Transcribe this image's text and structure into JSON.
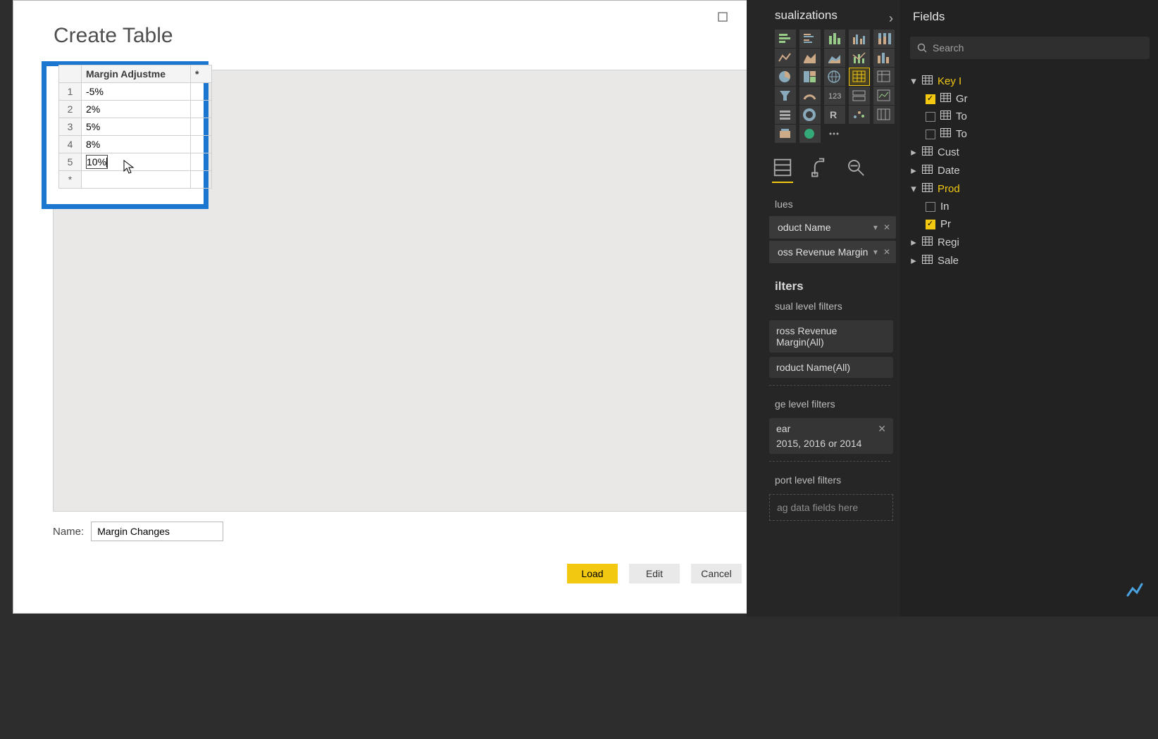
{
  "dialog": {
    "title": "Create Table",
    "column_header": "Margin Adjustme",
    "new_col_marker": "*",
    "rows": [
      {
        "n": "1",
        "v": "-5%"
      },
      {
        "n": "2",
        "v": "2%"
      },
      {
        "n": "3",
        "v": "5%"
      },
      {
        "n": "4",
        "v": "8%"
      },
      {
        "n": "5",
        "v": "10%"
      }
    ],
    "new_row_marker": "*",
    "name_label": "Name:",
    "name_value": "Margin Changes",
    "buttons": {
      "load": "Load",
      "edit": "Edit",
      "cancel": "Cancel"
    }
  },
  "vis": {
    "title": "sualizations",
    "values_label": "lues",
    "value_fields": [
      "oduct Name",
      "oss Revenue Margin"
    ],
    "filters_title": "ilters",
    "visual_filters_label": "sual level filters",
    "visual_filters": [
      "ross Revenue Margin(All)",
      "roduct Name(All)"
    ],
    "page_filters_label": "ge level filters",
    "page_filter_name": "ear",
    "page_filter_value": "2015, 2016 or 2014",
    "report_filters_label": "port level filters",
    "dropzone_text": "ag data fields here"
  },
  "fields": {
    "title": "Fields",
    "search_placeholder": "Search",
    "tables": [
      {
        "name": "Key I",
        "expanded": true,
        "highlight": true,
        "children": [
          {
            "name": "Gr",
            "checked": true,
            "icon": "table"
          },
          {
            "name": "To",
            "checked": false,
            "icon": "table"
          },
          {
            "name": "To",
            "checked": false,
            "icon": "table"
          }
        ]
      },
      {
        "name": "Cust",
        "expanded": false,
        "highlight": false
      },
      {
        "name": "Date",
        "expanded": false,
        "highlight": false
      },
      {
        "name": "Prod",
        "expanded": true,
        "highlight": true,
        "children": [
          {
            "name": "In",
            "checked": false,
            "icon": "none"
          },
          {
            "name": "Pr",
            "checked": true,
            "icon": "none"
          }
        ]
      },
      {
        "name": "Regi",
        "expanded": false,
        "highlight": false
      },
      {
        "name": "Sale",
        "expanded": false,
        "highlight": false
      }
    ]
  }
}
